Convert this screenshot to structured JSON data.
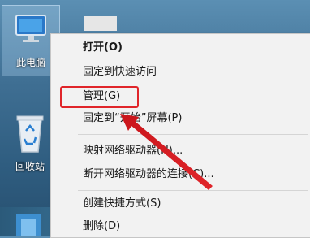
{
  "desktop": {
    "icons": [
      {
        "label": "此电脑"
      },
      {
        "label": "回收站"
      }
    ]
  },
  "context_menu": {
    "items": [
      {
        "label": "打开(O)",
        "bold": true
      },
      {
        "label": "固定到快速访问"
      },
      {
        "label": "管理(G)"
      },
      {
        "label": "固定到“开始”屏幕(P)"
      },
      {
        "label": "映射网络驱动器(N)..."
      },
      {
        "label": "断开网络驱动器的连接(C)..."
      },
      {
        "label": "创建快捷方式(S)"
      },
      {
        "label": "删除(D)"
      }
    ]
  },
  "highlight_color": "#e0252a"
}
